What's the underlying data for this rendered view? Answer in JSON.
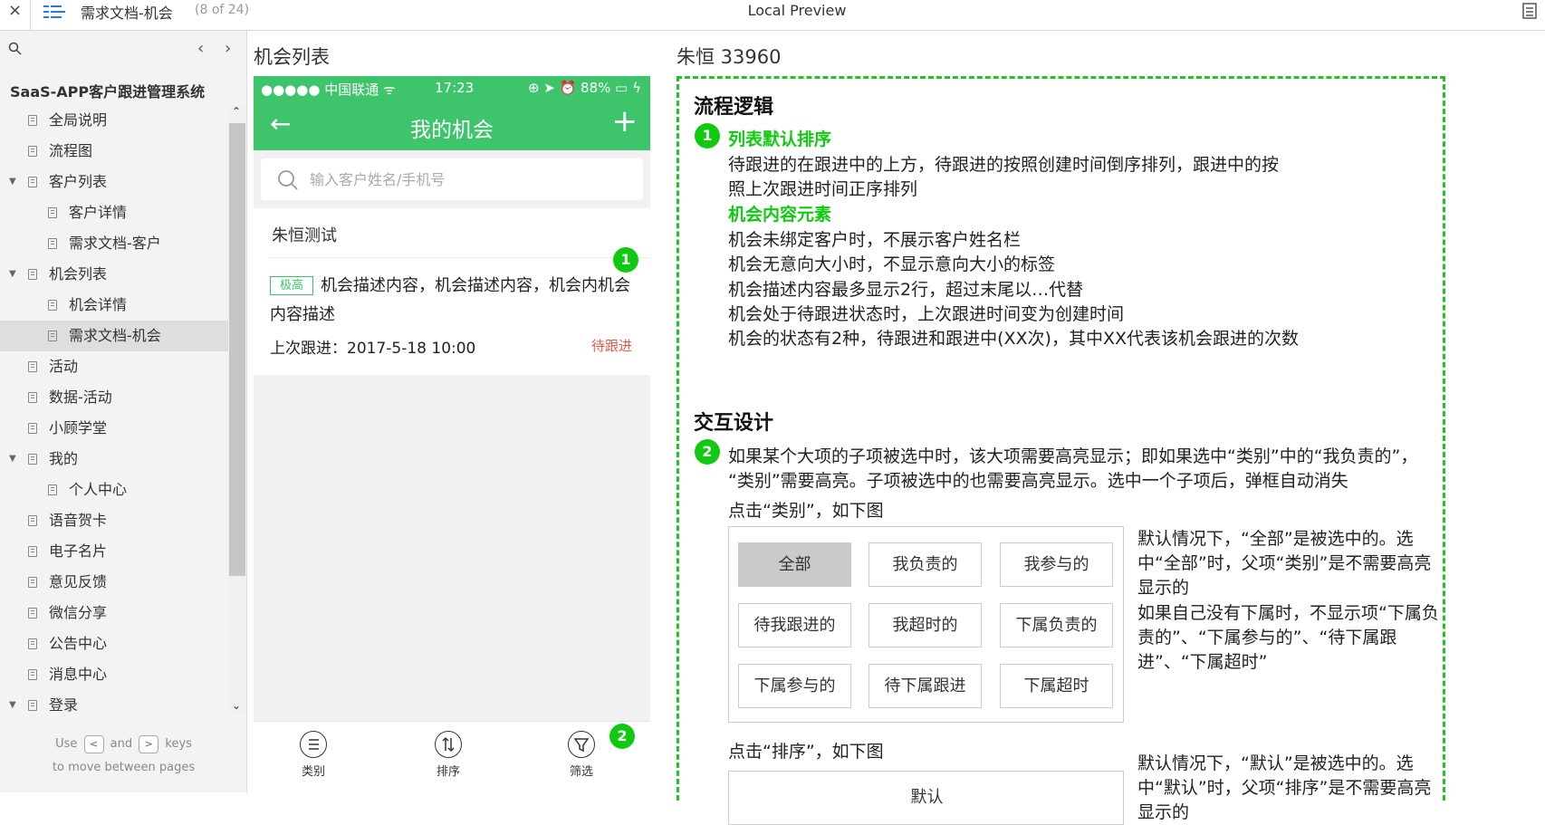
{
  "topbar": {
    "close": "×",
    "doc_title": "需求文档-机会",
    "page_count": "(8 of 24)",
    "app_title": "Local Preview"
  },
  "sidebar": {
    "project": "SaaS-APP客户跟进管理系统",
    "items": [
      {
        "label": "全局说明",
        "level": 0,
        "toggle": ""
      },
      {
        "label": "流程图",
        "level": 0,
        "toggle": ""
      },
      {
        "label": "客户列表",
        "level": 0,
        "toggle": "▼"
      },
      {
        "label": "客户详情",
        "level": 1,
        "toggle": ""
      },
      {
        "label": "需求文档-客户",
        "level": 1,
        "toggle": ""
      },
      {
        "label": "机会列表",
        "level": 0,
        "toggle": "▼"
      },
      {
        "label": "机会详情",
        "level": 1,
        "toggle": ""
      },
      {
        "label": "需求文档-机会",
        "level": 1,
        "toggle": "",
        "active": true
      },
      {
        "label": "活动",
        "level": 0,
        "toggle": ""
      },
      {
        "label": "数据-活动",
        "level": 0,
        "toggle": ""
      },
      {
        "label": "小顾学堂",
        "level": 0,
        "toggle": ""
      },
      {
        "label": "我的",
        "level": 0,
        "toggle": "▼"
      },
      {
        "label": "个人中心",
        "level": 1,
        "toggle": ""
      },
      {
        "label": "语音贺卡",
        "level": 0,
        "toggle": ""
      },
      {
        "label": "电子名片",
        "level": 0,
        "toggle": ""
      },
      {
        "label": "意见反馈",
        "level": 0,
        "toggle": ""
      },
      {
        "label": "微信分享",
        "level": 0,
        "toggle": ""
      },
      {
        "label": "公告中心",
        "level": 0,
        "toggle": ""
      },
      {
        "label": "消息中心",
        "level": 0,
        "toggle": ""
      },
      {
        "label": "登录",
        "level": 0,
        "toggle": "▼"
      }
    ],
    "help_use": "Use",
    "help_and": "and",
    "help_keys": "keys",
    "help_line2": "to move between pages",
    "key_prev": "<",
    "key_next": ">"
  },
  "middle": {
    "section_title": "机会列表",
    "status": {
      "carrier": "●●●●● 中国联通 ᯤ",
      "time": "17:23",
      "right": "⊕ ➤ ⏰ 88% ▭ ϟ"
    },
    "nav_title": "我的机会",
    "search_placeholder": "输入客户姓名/手机号",
    "card": {
      "customer": "朱恒测试",
      "badge": "极高",
      "desc": "机会描述内容，机会描述内容，机会内机会内容描述",
      "last": "上次跟进：2017-5-18 10:00",
      "state": "待跟进"
    },
    "tabs": [
      {
        "label": "类别",
        "icon": "≡"
      },
      {
        "label": "排序",
        "icon": "⇅"
      },
      {
        "label": "筛选",
        "icon": "⊽"
      }
    ],
    "marker1": "1",
    "marker2": "2"
  },
  "doc": {
    "header": "朱恒  33960",
    "logic_title": "流程逻辑",
    "marker1": "1",
    "sort_title": "列表默认排序",
    "sort_l1": "待跟进的在跟进中的上方，待跟进的按照创建时间倒序排列，跟进中的按",
    "sort_l2": "照上次跟进时间正序排列",
    "content_title": "机会内容元素",
    "content_lines": [
      "机会未绑定客户时，不展示客户姓名栏",
      "机会无意向大小时，不显示意向大小的标签",
      "机会描述内容最多显示2行，超过末尾以…代替",
      "机会处于待跟进状态时，上次跟进时间变为创建时间",
      "机会的状态有2种，待跟进和跟进中(XX次)，其中XX代表该机会跟进的次数"
    ],
    "interact_title": "交互设计",
    "marker2": "2",
    "inter_l1": "如果某个大项的子项被选中时，该大项需要高亮显示；即如果选中“类别”中的“我负责的”，",
    "inter_l2": "“类别”需要高亮。子项被选中的也需要高亮显示。选中一个子项后，弹框自动消失",
    "click_category": "点击“类别”，如下图",
    "grid": [
      [
        "全部",
        "我负责的",
        "我参与的"
      ],
      [
        "待我跟进的",
        "我超时的",
        "下属负责的"
      ],
      [
        "下属参与的",
        "待下属跟进",
        "下属超时"
      ]
    ],
    "note1": "默认情况下，“全部”是被选中的。选中“全部”时，父项“类别”是不需要高亮显示的",
    "note2": "如果自己没有下属时，不显示项“下属负责的”、“下属参与的”、“待下属跟进”、“下属超时”",
    "click_sort": "点击“排序”，如下图",
    "sort_first": "默认",
    "note3": "默认情况下，“默认”是被选中的。选中“默认”时，父项“排序”是不需要高亮显示的"
  },
  "colors": {
    "accent": "#3ec46a",
    "marker": "#11c911",
    "pending": "#e05b4c",
    "dash": "#22c322"
  }
}
